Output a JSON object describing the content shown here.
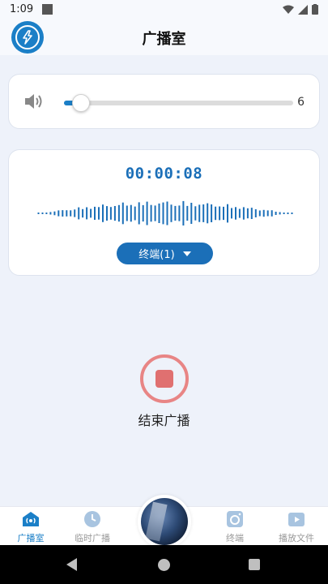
{
  "status_bar": {
    "time": "1:09"
  },
  "header": {
    "title": "广播室"
  },
  "volume": {
    "value": "6",
    "fraction": 0.05
  },
  "recording": {
    "timer": "00:00:08",
    "terminal_label": "终端(1)"
  },
  "stop": {
    "label": "结束广播"
  },
  "tabs": [
    {
      "label": "广播室",
      "active": true
    },
    {
      "label": "临时广播",
      "active": false
    },
    {
      "label": "终端",
      "active": false
    },
    {
      "label": "播放文件",
      "active": false
    }
  ],
  "colors": {
    "accent": "#1b7fc7",
    "stop": "#e07070",
    "background": "#eef2fa"
  },
  "icons": [
    "wifi-icon",
    "signal-icon",
    "battery-icon",
    "logo-icon",
    "speaker-icon",
    "broadcast-icon",
    "clock-icon",
    "terminal-icon",
    "play-file-icon",
    "stop-icon"
  ]
}
